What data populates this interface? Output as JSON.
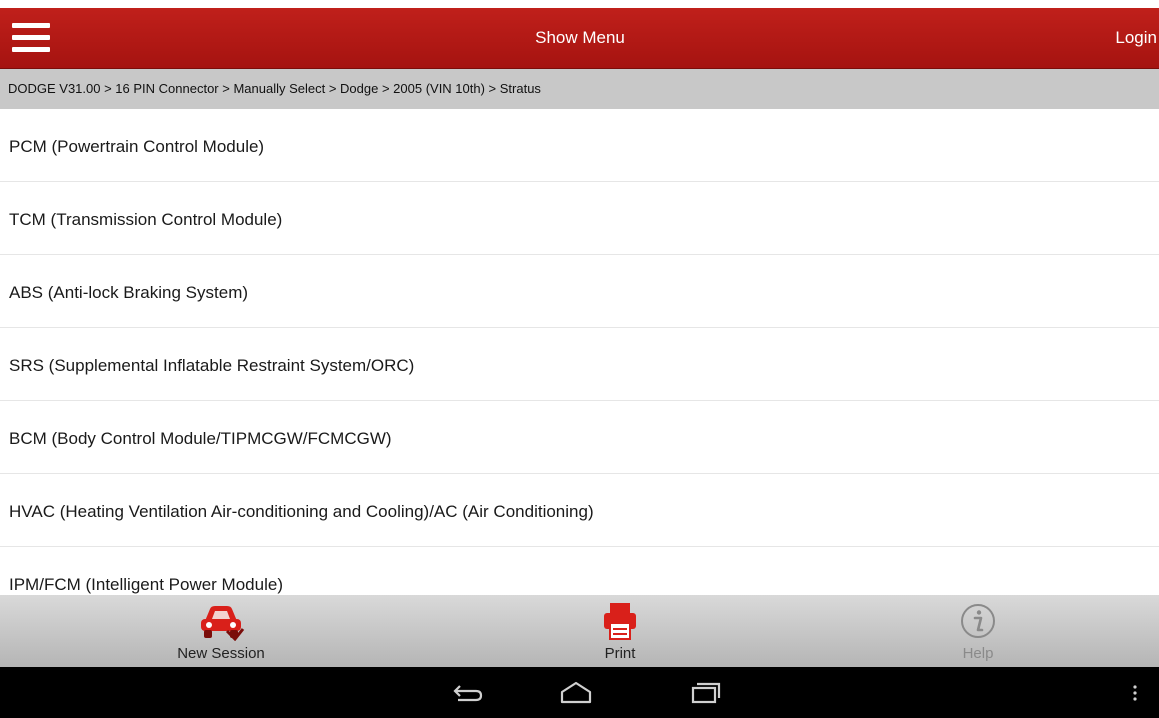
{
  "header": {
    "title": "Show Menu",
    "login_label": "Login",
    "accent_color": "#b01814"
  },
  "breadcrumb": {
    "text": "DODGE V31.00 > 16 PIN Connector > Manually Select > Dodge > 2005 (VIN 10th) > Stratus"
  },
  "modules": [
    {
      "label": "PCM (Powertrain Control Module)"
    },
    {
      "label": "TCM (Transmission Control Module)"
    },
    {
      "label": "ABS (Anti-lock Braking System)"
    },
    {
      "label": "SRS (Supplemental Inflatable Restraint System/ORC)"
    },
    {
      "label": "BCM (Body Control Module/TIPMCGW/FCMCGW)"
    },
    {
      "label": "HVAC (Heating Ventilation Air-conditioning and Cooling)/AC (Air Conditioning)"
    },
    {
      "label": "IPM/FCM (Intelligent Power Module)"
    }
  ],
  "bottom_bar": {
    "new_session_label": "New Session",
    "print_label": "Print",
    "help_label": "Help"
  },
  "icons": {
    "menu": "hamburger-icon",
    "new_session": "car-icon",
    "print": "printer-icon",
    "help": "info-icon",
    "back": "back-icon",
    "home": "home-icon",
    "recent": "recent-apps-icon",
    "overflow": "overflow-menu-icon"
  }
}
